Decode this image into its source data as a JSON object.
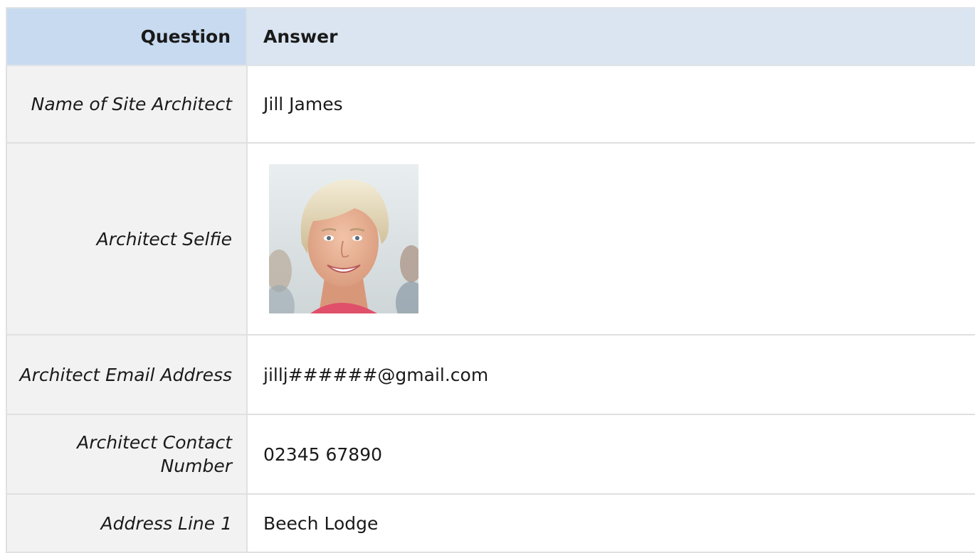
{
  "header": {
    "question": "Question",
    "answer": "Answer"
  },
  "rows": [
    {
      "question": "Name of Site Architect",
      "answer": "Jill James"
    },
    {
      "question": "Architect Selfie",
      "answer_image": "architect-portrait-photo"
    },
    {
      "question": "Architect Email Address",
      "answer": "jillj######@gmail.com"
    },
    {
      "question": "Architect Contact Number",
      "answer": "02345 67890"
    },
    {
      "question": "Address Line 1",
      "answer": "Beech Lodge"
    }
  ],
  "colors": {
    "question_header_bg": "#c7daf0",
    "answer_header_bg": "#dbe5f1",
    "question_cell_bg": "#f2f2f2",
    "answer_cell_bg": "#ffffff",
    "border": "#e0e0e0"
  }
}
